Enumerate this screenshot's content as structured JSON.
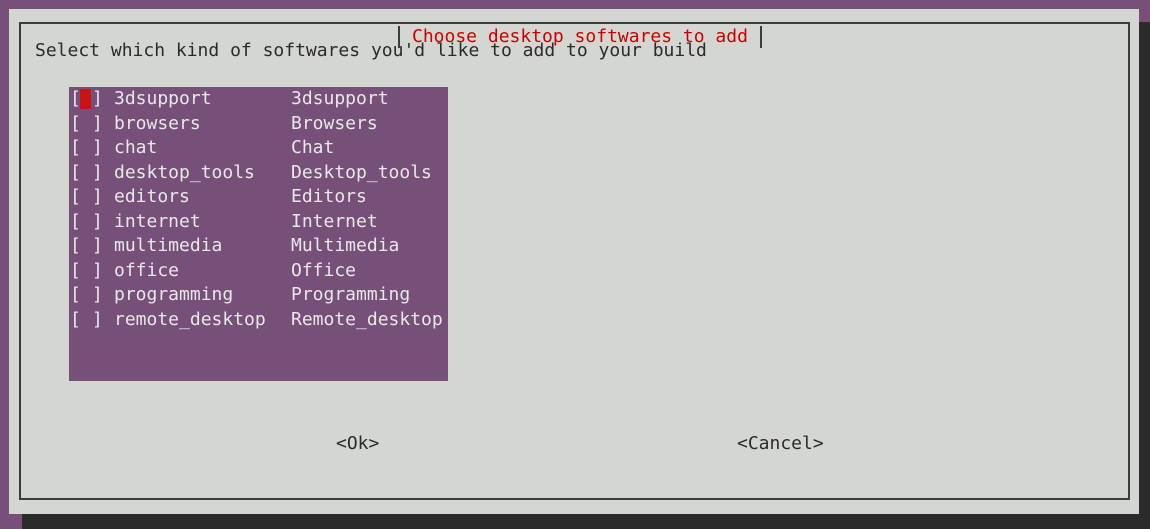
{
  "dialog": {
    "title": "Choose desktop softwares to add",
    "prompt": "Select which kind of softwares you'd like to add to your build",
    "list": {
      "checkbox_open": "[",
      "checkbox_close": "]",
      "items": [
        {
          "tag": "3dsupport",
          "description": "3dsupport",
          "checked": false,
          "focused": true
        },
        {
          "tag": "browsers",
          "description": "Browsers",
          "checked": false,
          "focused": false
        },
        {
          "tag": "chat",
          "description": "Chat",
          "checked": false,
          "focused": false
        },
        {
          "tag": "desktop_tools",
          "description": "Desktop_tools",
          "checked": false,
          "focused": false
        },
        {
          "tag": "editors",
          "description": "Editors",
          "checked": false,
          "focused": false
        },
        {
          "tag": "internet",
          "description": "Internet",
          "checked": false,
          "focused": false
        },
        {
          "tag": "multimedia",
          "description": "Multimedia",
          "checked": false,
          "focused": false
        },
        {
          "tag": "office",
          "description": "Office",
          "checked": false,
          "focused": false
        },
        {
          "tag": "programming",
          "description": "Programming",
          "checked": false,
          "focused": false
        },
        {
          "tag": "remote_desktop",
          "description": "Remote_desktop",
          "checked": false,
          "focused": false
        }
      ]
    },
    "buttons": {
      "ok_label": "<Ok>",
      "cancel_label": "<Cancel>"
    }
  },
  "colors": {
    "terminal_background": "#77507a",
    "dialog_background": "#d3d6d1",
    "title_text": "#cc0000",
    "list_background": "#77507a",
    "list_text": "#e8e8e8",
    "cursor": "#c81414",
    "shadow": "#2b2b2b"
  }
}
